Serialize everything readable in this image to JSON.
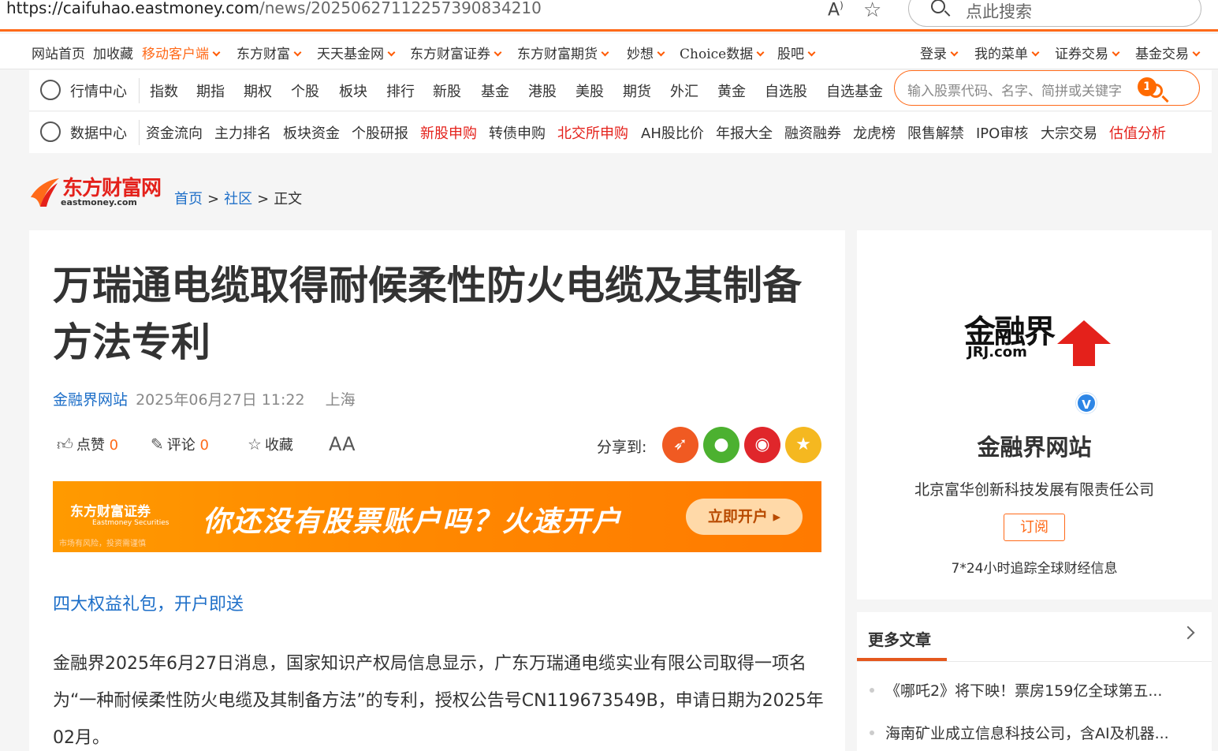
{
  "browser": {
    "url_host": "https://caifuhao.eastmoney.com",
    "url_path": "/news/20250627112257390834210",
    "search_placeholder": "点此搜索"
  },
  "topnav": {
    "items": [
      {
        "label": "网站首页",
        "dropdown": false
      },
      {
        "label": "加收藏",
        "dropdown": false
      },
      {
        "label": "移动客户端",
        "dropdown": true,
        "highlight": true
      },
      {
        "label": "东方财富",
        "dropdown": true
      },
      {
        "label": "天天基金网",
        "dropdown": true
      },
      {
        "label": "东方财富证券",
        "dropdown": true
      },
      {
        "label": "东方财富期货",
        "dropdown": true
      },
      {
        "label": "妙想",
        "dropdown": true
      },
      {
        "label": "Choice数据",
        "dropdown": true
      },
      {
        "label": "股吧",
        "dropdown": true
      }
    ],
    "right_items": [
      {
        "label": "登录"
      },
      {
        "label": "我的菜单"
      },
      {
        "label": "证券交易"
      },
      {
        "label": "基金交易"
      }
    ]
  },
  "quote_nav": {
    "title": "行情中心",
    "links": [
      "指数",
      "期指",
      "期权",
      "个股",
      "板块",
      "排行",
      "新股",
      "基金",
      "港股",
      "美股",
      "期货",
      "外汇",
      "黄金",
      "自选股",
      "自选基金"
    ],
    "search_placeholder": "输入股票代码、名字、简拼或关键字",
    "search_badge": "1"
  },
  "data_nav": {
    "title": "数据中心",
    "links": [
      {
        "label": "资金流向",
        "red": false
      },
      {
        "label": "主力排名",
        "red": false
      },
      {
        "label": "板块资金",
        "red": false
      },
      {
        "label": "个股研报",
        "red": false
      },
      {
        "label": "新股申购",
        "red": true
      },
      {
        "label": "转债申购",
        "red": false
      },
      {
        "label": "北交所申购",
        "red": true
      },
      {
        "label": "AH股比价",
        "red": false
      },
      {
        "label": "年报大全",
        "red": false
      },
      {
        "label": "融资融券",
        "red": false
      },
      {
        "label": "龙虎榜",
        "red": false
      },
      {
        "label": "限售解禁",
        "red": false
      },
      {
        "label": "IPO审核",
        "red": false
      },
      {
        "label": "大宗交易",
        "red": false
      },
      {
        "label": "估值分析",
        "red": true
      }
    ]
  },
  "logo": {
    "cn": "东方财富网",
    "en": "eastmoney.com"
  },
  "breadcrumb": {
    "home": "首页",
    "community": "社区",
    "sep": ">",
    "current": "正文"
  },
  "article": {
    "title": "万瑞通电缆取得耐候柔性防火电缆及其制备方法专利",
    "source": "金融界网站",
    "date": "2025年06月27日 11:22",
    "location": "上海",
    "like_label": "点赞",
    "like_count": "0",
    "comment_label": "评论",
    "comment_count": "0",
    "collect_label": "收藏",
    "font_label": "AA",
    "share_label": "分享到:",
    "banner": {
      "brand_cn": "东方财富证券",
      "brand_en": "Eastmoney Securities",
      "risk": "市场有风险，投资需谨慎",
      "slogan": "你还没有股票账户吗？火速开户",
      "button": "立即开户 ▸"
    },
    "promo_link": "四大权益礼包，开户即送",
    "body": "金融界2025年6月27日消息，国家知识产权局信息显示，广东万瑞通电缆实业有限公司取得一项名为“一种耐候柔性防火电缆及其制备方法”的专利，授权公告号CN119673549B，申请日期为2025年02月。"
  },
  "sidebar": {
    "logo_cn": "金融界",
    "logo_en": "JRJ.com",
    "verified": "V",
    "name": "金融界网站",
    "company": "北京富华创新科技发展有限责任公司",
    "subscribe": "订阅",
    "desc": "7*24小时追踪全球财经信息"
  },
  "more": {
    "title": "更多文章",
    "items": [
      "《哪吒2》将下映！票房159亿全球第五...",
      "海南矿业成立信息科技公司，含AI及机器..."
    ]
  },
  "colors": {
    "accent": "#ff6a19",
    "link": "#1e6fc8",
    "red": "#e4211b"
  }
}
